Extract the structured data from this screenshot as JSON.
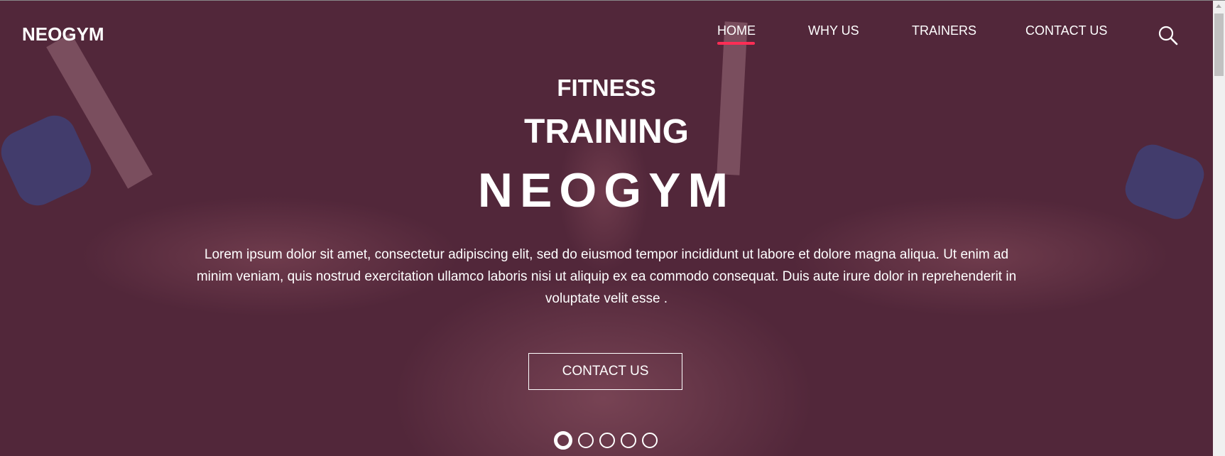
{
  "header": {
    "logo": "NEOGYM",
    "nav": [
      {
        "label": "HOME",
        "active": true
      },
      {
        "label": "WHY US"
      },
      {
        "label": "TRAINERS"
      },
      {
        "label": "CONTACT US"
      }
    ],
    "search_icon": "search-icon",
    "accent": "#ff2d55"
  },
  "hero": {
    "line1": "FITNESS",
    "line2": "TRAINING",
    "line3": "NEOGYM",
    "paragraph": "Lorem ipsum dolor sit amet, consectetur adipiscing elit, sed do eiusmod tempor incididunt ut labore et dolore magna aliqua. Ut enim ad minim veniam, quis nostrud exercitation ullamco laboris nisi ut aliquip ex ea commodo consequat. Duis aute irure dolor in reprehenderit in voluptate velit esse .",
    "cta": "CONTACT US",
    "background": "#52273a"
  },
  "carousel": {
    "slides": 5,
    "active": 1
  }
}
